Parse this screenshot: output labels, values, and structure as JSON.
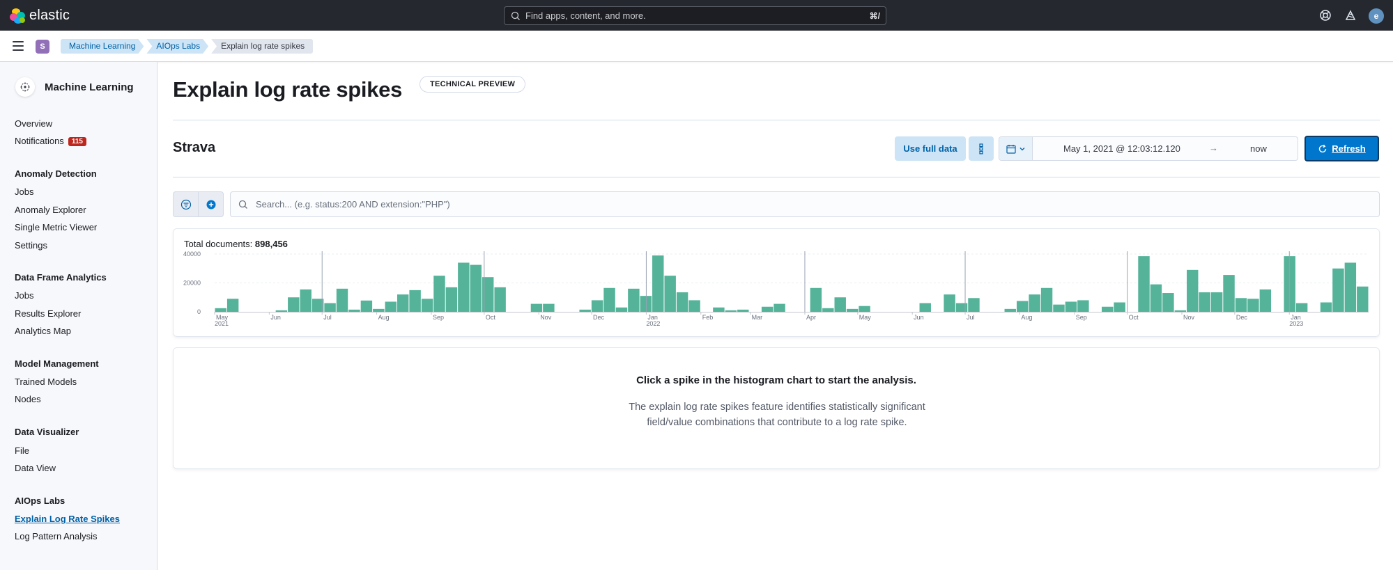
{
  "header": {
    "logo_text": "elastic",
    "search_placeholder": "Find apps, content, and more.",
    "search_shortcut": "⌘/",
    "avatar_initial": "e"
  },
  "breadcrumbs": {
    "space_initial": "S",
    "items": [
      "Machine Learning",
      "AIOps Labs",
      "Explain log rate spikes"
    ]
  },
  "sidebar": {
    "title": "Machine Learning",
    "overview": "Overview",
    "notifications": "Notifications",
    "notifications_count": "115",
    "sections": [
      {
        "title": "Anomaly Detection",
        "items": [
          "Jobs",
          "Anomaly Explorer",
          "Single Metric Viewer",
          "Settings"
        ]
      },
      {
        "title": "Data Frame Analytics",
        "items": [
          "Jobs",
          "Results Explorer",
          "Analytics Map"
        ]
      },
      {
        "title": "Model Management",
        "items": [
          "Trained Models",
          "Nodes"
        ]
      },
      {
        "title": "Data Visualizer",
        "items": [
          "File",
          "Data View"
        ]
      },
      {
        "title": "AIOps Labs",
        "items": [
          "Explain Log Rate Spikes",
          "Log Pattern Analysis"
        ]
      }
    ],
    "active_item": "Explain Log Rate Spikes"
  },
  "page": {
    "title": "Explain log rate spikes",
    "badge": "TECHNICAL PREVIEW",
    "data_view": "Strava",
    "use_full_data": "Use full data",
    "date_start": "May 1, 2021 @ 12:03:12.120",
    "date_arrow": "→",
    "date_end": "now",
    "refresh": "Refresh",
    "search_placeholder": "Search... (e.g. status:200 AND extension:\"PHP\")",
    "total_label": "Total documents:",
    "total_value": "898,456",
    "empty_title": "Click a spike in the histogram chart to start the analysis.",
    "empty_body": "The explain log rate spikes feature identifies statistically significant field/value combinations that contribute to a log rate spike."
  },
  "colors": {
    "bar": "#54b399",
    "primary": "#0077cc",
    "header_bg": "#25282f"
  },
  "chart_data": {
    "type": "bar",
    "title": "",
    "ylim": [
      0,
      40000
    ],
    "y_ticks": [
      0,
      20000,
      40000
    ],
    "x_ticks": [
      {
        "label": "May",
        "sub": "2021",
        "x": "2021-05"
      },
      {
        "label": "Jun",
        "sub": "",
        "x": "2021-06"
      },
      {
        "label": "Jul",
        "sub": "",
        "x": "2021-07"
      },
      {
        "label": "Aug",
        "sub": "",
        "x": "2021-08"
      },
      {
        "label": "Sep",
        "sub": "",
        "x": "2021-09"
      },
      {
        "label": "Oct",
        "sub": "",
        "x": "2021-10"
      },
      {
        "label": "Nov",
        "sub": "",
        "x": "2021-11"
      },
      {
        "label": "Dec",
        "sub": "",
        "x": "2021-12"
      },
      {
        "label": "Jan",
        "sub": "2022",
        "x": "2022-01"
      },
      {
        "label": "Feb",
        "sub": "",
        "x": "2022-02"
      },
      {
        "label": "Mar",
        "sub": "",
        "x": "2022-03"
      },
      {
        "label": "Apr",
        "sub": "",
        "x": "2022-04"
      },
      {
        "label": "May",
        "sub": "",
        "x": "2022-05"
      },
      {
        "label": "Jun",
        "sub": "",
        "x": "2022-06"
      },
      {
        "label": "Jul",
        "sub": "",
        "x": "2022-07"
      },
      {
        "label": "Aug",
        "sub": "",
        "x": "2022-08"
      },
      {
        "label": "Sep",
        "sub": "",
        "x": "2022-09"
      },
      {
        "label": "Oct",
        "sub": "",
        "x": "2022-10"
      },
      {
        "label": "Nov",
        "sub": "",
        "x": "2022-11"
      },
      {
        "label": "Dec",
        "sub": "",
        "x": "2022-12"
      },
      {
        "label": "Jan",
        "sub": "2023",
        "x": "2023-01"
      }
    ],
    "bucket": "week",
    "values": [
      2500,
      9000,
      0,
      0,
      0,
      1000,
      10000,
      15500,
      9000,
      6000,
      16000,
      1500,
      7800,
      2000,
      7000,
      12000,
      15000,
      9000,
      25000,
      17000,
      34000,
      32500,
      24000,
      17000,
      0,
      0,
      5500,
      5500,
      0,
      0,
      1500,
      8000,
      16500,
      3000,
      16000,
      11000,
      39000,
      25000,
      13500,
      8000,
      0,
      3000,
      1000,
      1500,
      0,
      3500,
      5500,
      0,
      0,
      16500,
      2500,
      10000,
      2000,
      4000,
      0,
      0,
      0,
      0,
      6000,
      0,
      12000,
      6000,
      9500,
      0,
      0,
      2000,
      7500,
      12000,
      16500,
      5000,
      7000,
      8000,
      0,
      3500,
      6500,
      0,
      38500,
      19000,
      13000,
      1000,
      29000,
      13500,
      13500,
      25500,
      9500,
      9000,
      15500,
      0,
      38500,
      6000,
      0,
      6500,
      30000,
      34000,
      17500
    ]
  }
}
